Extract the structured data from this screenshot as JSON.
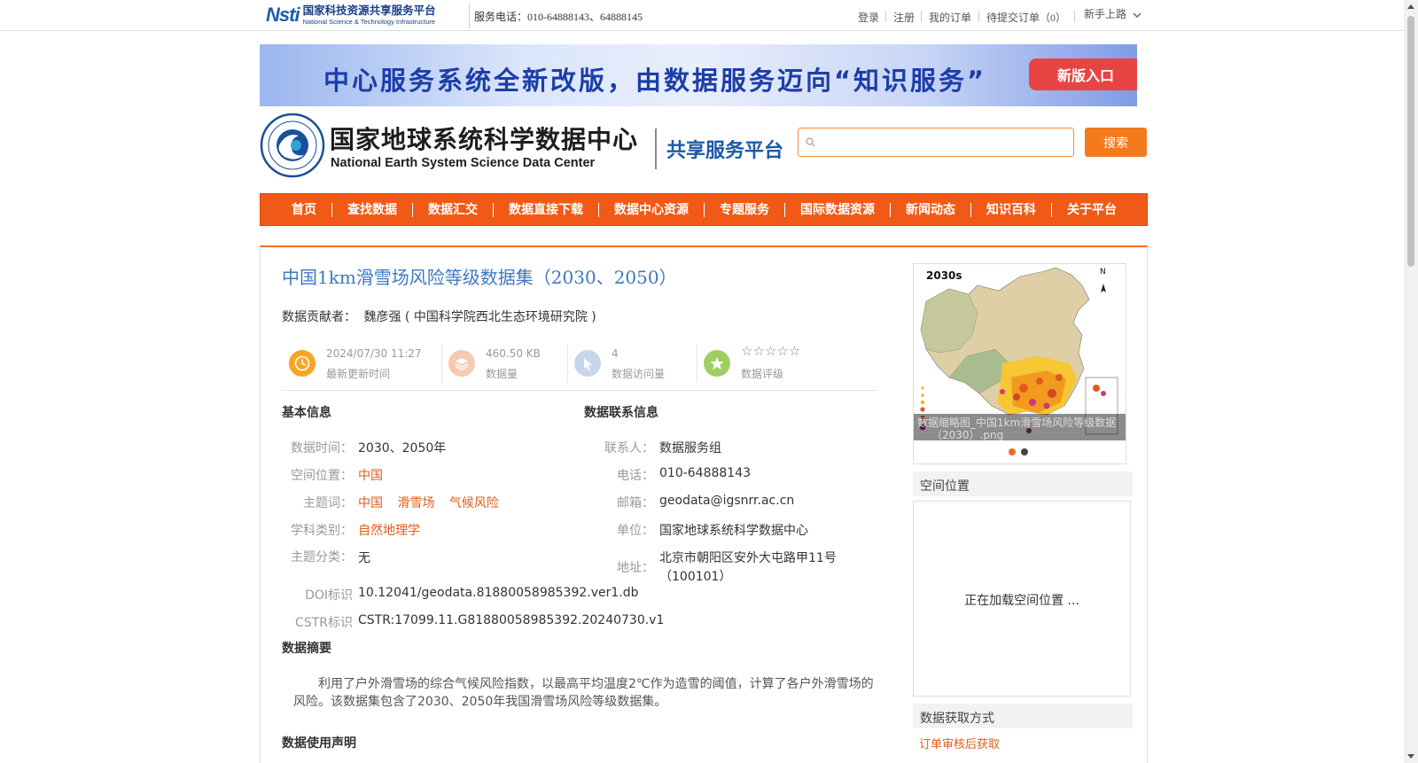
{
  "topbar": {
    "logo_mark": "Nsti",
    "logo_cn": "国家科技资源共享服务平台",
    "logo_en": "National Science & Technology Infrastructure",
    "service_phone": "服务电话：010-64888143、64888145",
    "login": "登录",
    "register": "注册",
    "my_orders": "我的订单",
    "pending_orders": "待提交订单（0）",
    "newbie_guide": "新手上路"
  },
  "banner": {
    "text": "中心服务系统全新改版，由数据服务迈向“知识服务”",
    "button": "新版入口"
  },
  "header": {
    "title_cn": "国家地球系统科学数据中心",
    "title_en": "National Earth System Science Data Center",
    "subtitle": "共享服务平台",
    "search_placeholder": "",
    "search_button": "搜索"
  },
  "nav": [
    "首页",
    "查找数据",
    "数据汇交",
    "数据直接下载",
    "数据中心资源",
    "专题服务",
    "国际数据资源",
    "新闻动态",
    "知识百科",
    "关于平台"
  ],
  "dataset": {
    "title": "中国1km滑雪场风险等级数据集（2030、2050）",
    "contributor_label": "数据贡献者：",
    "contributor": "魏彦强 ( 中国科学院西北生态环境研究院 )",
    "stats": {
      "updated_value": "2024/07/30 11:27",
      "updated_label": "最新更新时间",
      "size_value": "460.50 KB",
      "size_label": "数据量",
      "visits_value": "4",
      "visits_label": "数据访问量",
      "rating_stars": "☆☆☆☆☆",
      "rating_label": "数据评级",
      "rating_value": 0
    },
    "basic_info_title": "基本信息",
    "basic_info": {
      "time_label": "数据时间：",
      "time_value": "2030、2050年",
      "location_label": "空间位置：",
      "location_value": "中国",
      "keywords_label": "主题词：",
      "keywords": [
        "中国",
        "滑雪场",
        "气候风险"
      ],
      "discipline_label": "学科类别：",
      "discipline_value": "自然地理学",
      "category_label": "主题分类：",
      "category_value": "无",
      "doi_label": "DOI标识",
      "doi_value": "10.12041/geodata.81880058985392.ver1.db",
      "cstr_label": "CSTR标识",
      "cstr_value": "CSTR:17099.11.G81880058985392.20240730.v1"
    },
    "contact_title": "数据联系信息",
    "contact": {
      "person_label": "联系人：",
      "person_value": "数据服务组",
      "phone_label": "电话：",
      "phone_value": "010-64888143",
      "email_label": "邮箱：",
      "email_value": "geodata@igsnrr.ac.cn",
      "unit_label": "单位：",
      "unit_value": "国家地球系统科学数据中心",
      "address_label": "地址：",
      "address_line1": "北京市朝阳区安外大屯路甲11号",
      "address_line2": "（100101）"
    },
    "abstract_title": "数据摘要",
    "abstract": "利用了户外滑雪场的综合气候风险指数，以最高平均温度2℃作为造雪的阈值，计算了各户外滑雪场的风险。该数据集包含了2030、2050年我国滑雪场风险等级数据集。",
    "usage_title": "数据使用声明"
  },
  "sidebar": {
    "thumb_label": "2030s",
    "thumb_caption_line1": "数据缩略图_中国1km滑雪场风险等级数据",
    "thumb_caption_line2": "（2030）.png",
    "thumb_north": "N",
    "spatial_title": "空间位置",
    "spatial_loading": "正在加载空间位置 ...",
    "access_title": "数据获取方式",
    "access_method": "订单审核后获取"
  },
  "colors": {
    "accent": "#f05a16",
    "link_blue": "#3d78c3",
    "orange_text": "#e25d18"
  }
}
